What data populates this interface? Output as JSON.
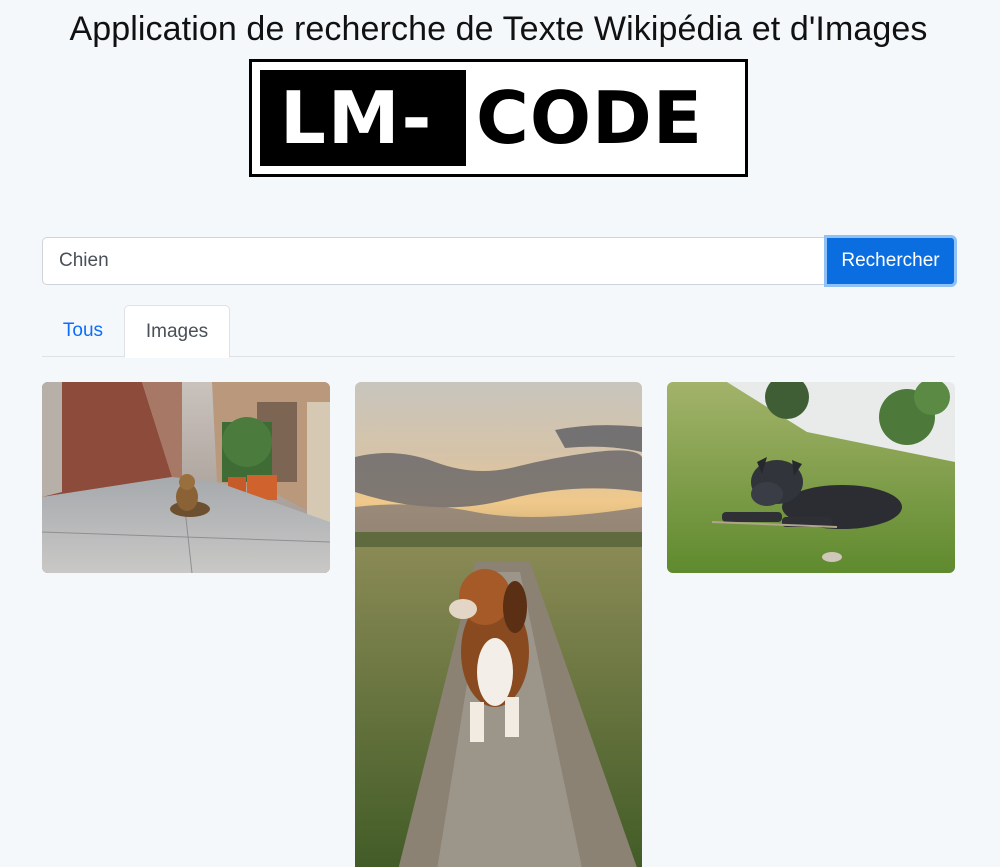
{
  "header": {
    "title": "Application de recherche de Texte Wikipédia et d'Images"
  },
  "logo": {
    "left_text": "LM-",
    "right_text": "CODE"
  },
  "search": {
    "value": "Chien",
    "button_label": "Rechercher"
  },
  "tabs": [
    {
      "label": "Tous",
      "active": false
    },
    {
      "label": "Images",
      "active": true
    }
  ],
  "results": [
    {
      "subject": "dog lying on a city alley street"
    },
    {
      "subject": "beagle sitting on a grassy path at sunset"
    },
    {
      "subject": "black cane corso lying in the grass"
    }
  ],
  "colors": {
    "accent": "#0b6ee0",
    "link": "#0d6efd",
    "background": "#f4f8fb"
  }
}
